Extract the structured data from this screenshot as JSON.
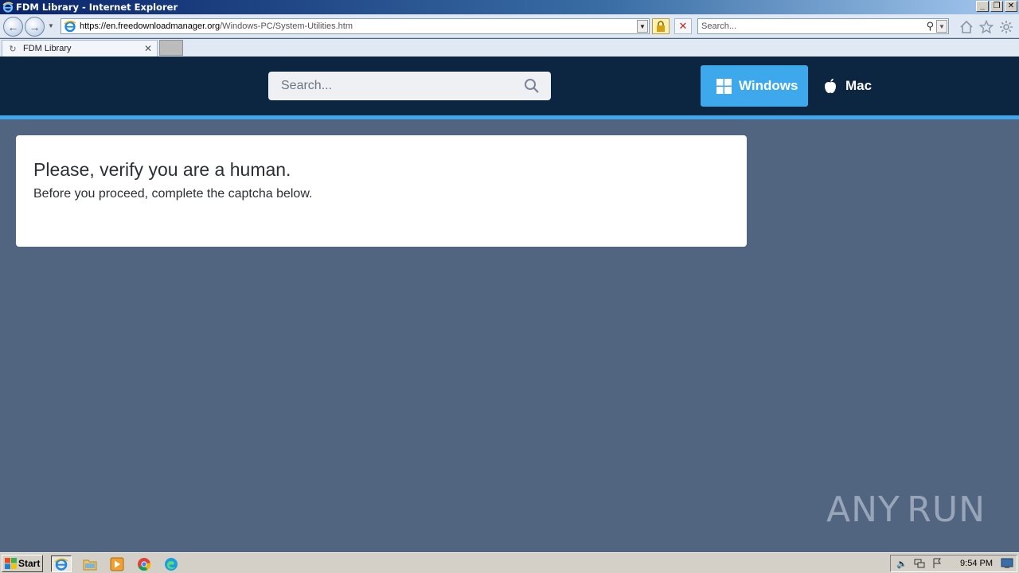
{
  "window": {
    "title": "FDM Library - Internet Explorer",
    "controls": {
      "minimize": "_",
      "maximize": "❐",
      "close": "✕"
    }
  },
  "address_bar": {
    "url_host": "https://en.freedownloadmanager.org",
    "url_path": "/Windows-PC/System-Utilities.htm"
  },
  "ie_search": {
    "placeholder": "Search..."
  },
  "tabs": [
    {
      "label": "FDM Library",
      "loading": true
    }
  ],
  "site": {
    "search_placeholder": "Search...",
    "os_buttons": [
      {
        "label": "Windows",
        "active": true,
        "icon": "windows-logo-icon"
      },
      {
        "label": "Mac",
        "active": false,
        "icon": "apple-logo-icon"
      }
    ],
    "colors": {
      "header": "#0c2540",
      "accent": "#3ea8ec",
      "background": "#526580"
    }
  },
  "card": {
    "heading": "Please, verify you are a human.",
    "text": "Before you proceed, complete the captcha below."
  },
  "watermark": {
    "left": "ANY",
    "right": "RUN"
  },
  "taskbar": {
    "start_label": "Start",
    "apps": [
      "internet-explorer-icon",
      "file-explorer-icon",
      "media-player-icon",
      "chrome-icon",
      "edge-icon"
    ],
    "clock": "9:54 PM"
  }
}
